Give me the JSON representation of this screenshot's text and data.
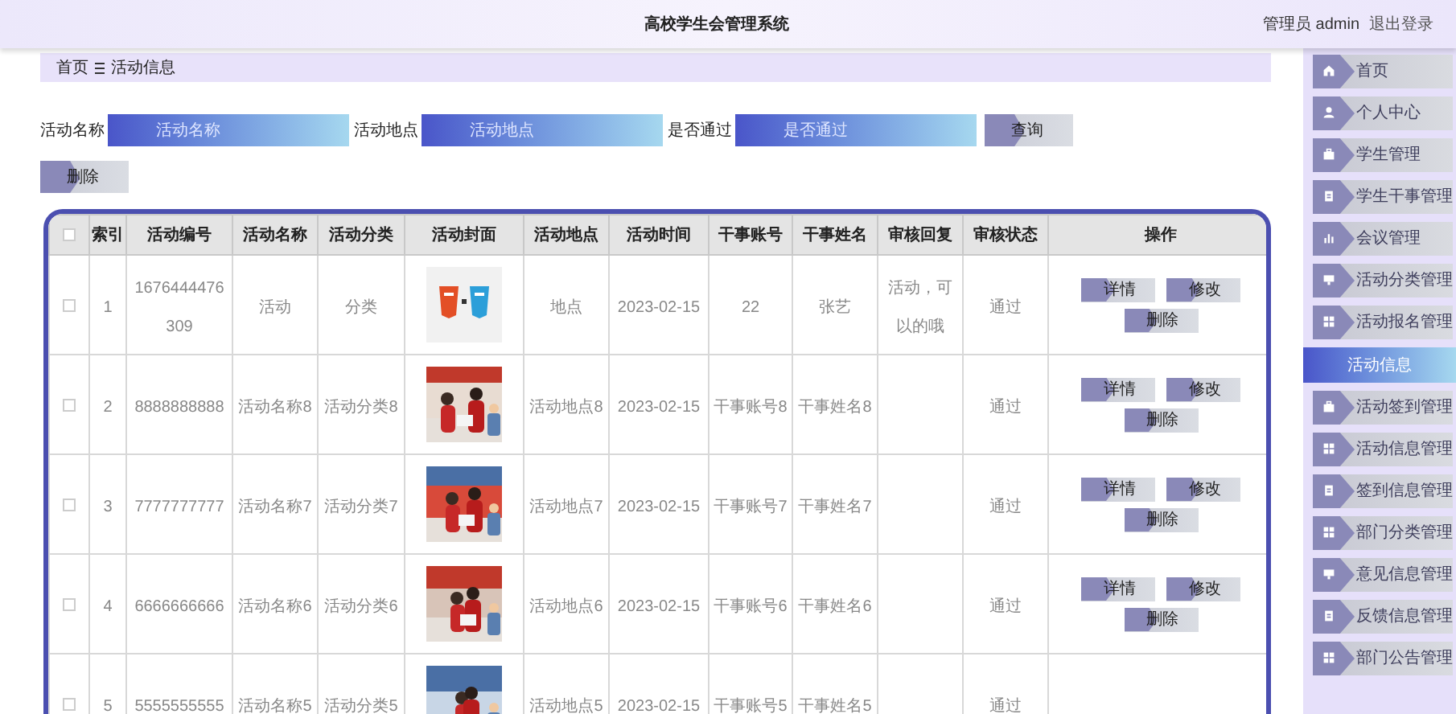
{
  "header": {
    "title": "高校学生会管理系统",
    "user": "管理员 admin",
    "logout": "退出登录"
  },
  "breadcrumb": {
    "home": "首页",
    "current": "活动信息"
  },
  "search": {
    "fields": [
      {
        "label": "活动名称",
        "placeholder": "活动名称"
      },
      {
        "label": "活动地点",
        "placeholder": "活动地点"
      },
      {
        "label": "是否通过",
        "placeholder": "是否通过"
      }
    ],
    "query_button": "查询",
    "delete_button": "删除"
  },
  "table": {
    "select_all": {
      "checked": false
    },
    "columns": [
      "索引",
      "活动编号",
      "活动名称",
      "活动分类",
      "活动封面",
      "活动地点",
      "活动时间",
      "干事账号",
      "干事姓名",
      "审核回复",
      "审核状态",
      "操作"
    ],
    "rows": [
      {
        "checked": false,
        "index": "1",
        "code": "1676444476309",
        "name": "活动",
        "category": "分类",
        "place": "地点",
        "time": "2023-02-15",
        "staff_account": "22",
        "staff_name": "张艺",
        "reply": "活动，可以的哦",
        "status": "通过",
        "actions": [
          "详情",
          "修改",
          "删除"
        ]
      },
      {
        "checked": false,
        "index": "2",
        "code": "8888888888",
        "name": "活动名称8",
        "category": "活动分类8",
        "place": "活动地点8",
        "time": "2023-02-15",
        "staff_account": "干事账号8",
        "staff_name": "干事姓名8",
        "reply": "",
        "status": "通过",
        "actions": [
          "详情",
          "修改",
          "删除"
        ]
      },
      {
        "checked": false,
        "index": "3",
        "code": "7777777777",
        "name": "活动名称7",
        "category": "活动分类7",
        "place": "活动地点7",
        "time": "2023-02-15",
        "staff_account": "干事账号7",
        "staff_name": "干事姓名7",
        "reply": "",
        "status": "通过",
        "actions": [
          "详情",
          "修改",
          "删除"
        ]
      },
      {
        "checked": false,
        "index": "4",
        "code": "6666666666",
        "name": "活动名称6",
        "category": "活动分类6",
        "place": "活动地点6",
        "time": "2023-02-15",
        "staff_account": "干事账号6",
        "staff_name": "干事姓名6",
        "reply": "",
        "status": "通过",
        "actions": [
          "详情",
          "修改",
          "删除"
        ]
      },
      {
        "checked": false,
        "index": "5",
        "code": "5555555555",
        "name": "活动名称5",
        "category": "活动分类5",
        "place": "活动地点5",
        "time": "2023-02-15",
        "staff_account": "干事账号5",
        "staff_name": "干事姓名5",
        "reply": "",
        "status": "通过",
        "actions": []
      }
    ]
  },
  "sidebar": {
    "items": [
      {
        "label": "首页",
        "selected": false
      },
      {
        "label": "个人中心",
        "selected": false
      },
      {
        "label": "学生管理",
        "selected": false
      },
      {
        "label": "学生干事管理",
        "selected": false
      },
      {
        "label": "会议管理",
        "selected": false
      },
      {
        "label": "活动分类管理",
        "selected": false
      },
      {
        "label": "活动报名管理",
        "selected": false
      },
      {
        "label": "活动信息",
        "selected": true
      },
      {
        "label": "活动签到管理",
        "selected": false
      },
      {
        "label": "活动信息管理",
        "selected": false
      },
      {
        "label": "签到信息管理",
        "selected": false
      },
      {
        "label": "部门分类管理",
        "selected": false
      },
      {
        "label": "意见信息管理",
        "selected": false
      },
      {
        "label": "反馈信息管理",
        "selected": false
      },
      {
        "label": "部门公告管理",
        "selected": false
      }
    ]
  }
}
